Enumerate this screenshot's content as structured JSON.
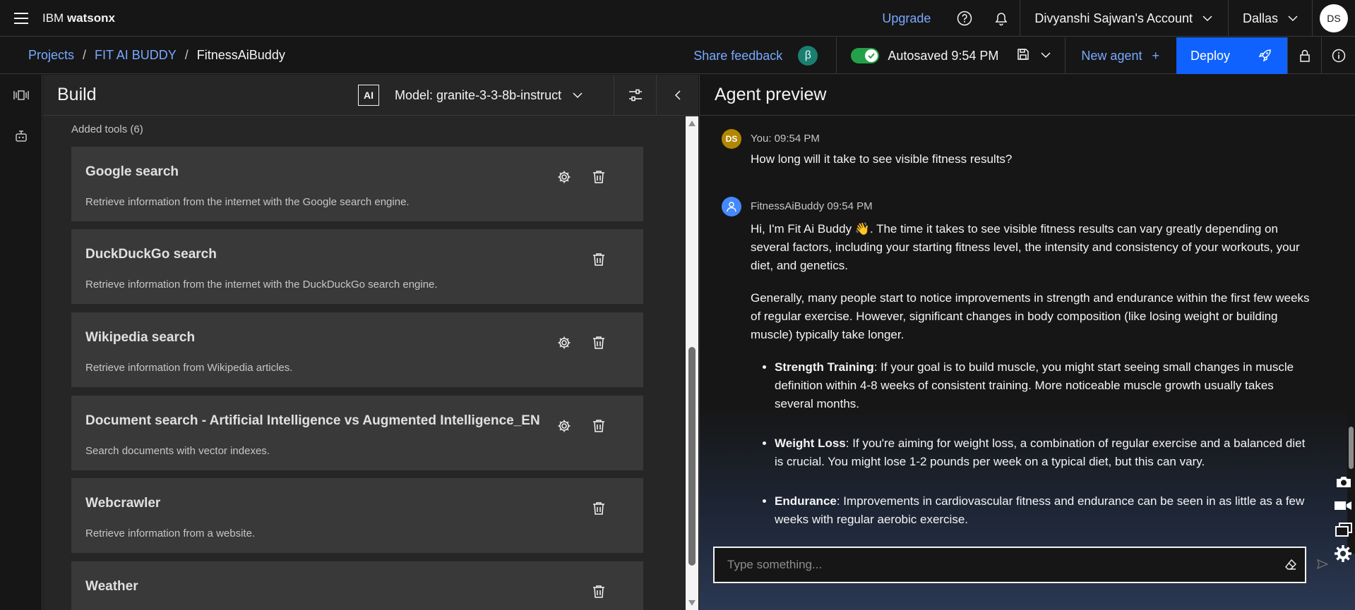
{
  "header": {
    "brand_prefix": "IBM ",
    "brand_name": "watsonx",
    "upgrade": "Upgrade",
    "account": "Divyanshi Sajwan's Account",
    "region": "Dallas",
    "avatar": "DS"
  },
  "subheader": {
    "breadcrumb": [
      "Projects",
      "FIT AI BUDDY",
      "FitnessAiBuddy"
    ],
    "separator": "/",
    "share_feedback": "Share feedback",
    "beta": "β",
    "autosaved": "Autosaved 9:54 PM",
    "new_agent": "New agent",
    "new_agent_plus": "+",
    "deploy": "Deploy"
  },
  "build": {
    "title": "Build",
    "ai_badge": "AI",
    "model": "Model: granite-3-3-8b-instruct",
    "tools_label": "Added tools (6)",
    "tools": [
      {
        "title": "Google search",
        "desc": "Retrieve information from the internet with the Google search engine.",
        "has_settings": true
      },
      {
        "title": "DuckDuckGo search",
        "desc": "Retrieve information from the internet with the DuckDuckGo search engine.",
        "has_settings": false
      },
      {
        "title": "Wikipedia search",
        "desc": "Retrieve information from Wikipedia articles.",
        "has_settings": true
      },
      {
        "title": "Document search - Artificial Intelligence vs Augmented Intelligence_EN",
        "desc": "Search documents with vector indexes.",
        "has_settings": true
      },
      {
        "title": "Webcrawler",
        "desc": "Retrieve information from a website.",
        "has_settings": false
      },
      {
        "title": "Weather",
        "desc": "",
        "has_settings": false
      }
    ]
  },
  "preview": {
    "title": "Agent preview",
    "user": {
      "avatar": "DS",
      "meta": "You: 09:54 PM",
      "text": "How long will it take to see visible fitness results?"
    },
    "bot": {
      "meta": "FitnessAiBuddy 09:54 PM",
      "p1": "Hi, I'm Fit Ai Buddy 👋. The time it takes to see visible fitness results can vary greatly depending on several factors, including your starting fitness level, the intensity and consistency of your workouts, your diet, and genetics.",
      "p2": "Generally, many people start to notice improvements in strength and endurance within the first few weeks of regular exercise. However, significant changes in body composition (like losing weight or building muscle) typically take longer.",
      "bullets": [
        {
          "term": "Strength Training",
          "text": ": If your goal is to build muscle, you might start seeing small changes in muscle definition within 4-8 weeks of consistent training. More noticeable muscle growth usually takes several months."
        },
        {
          "term": "Weight Loss",
          "text": ": If you're aiming for weight loss, a combination of regular exercise and a balanced diet is crucial. You might lose 1-2 pounds per week on a typical diet, but this can vary."
        },
        {
          "term": "Endurance",
          "text": ": Improvements in cardiovascular fitness and endurance can be seen in as little as a few weeks with regular aerobic exercise."
        }
      ]
    },
    "input_placeholder": "Type something..."
  },
  "colors": {
    "accent": "#0f62fe",
    "link": "#78a9ff",
    "toggle_on": "#24a148",
    "user_avatar": "#b28600",
    "bot_avatar": "#4589ff"
  },
  "icons": [
    "menu-icon",
    "help-icon",
    "notification-icon",
    "chevron-down-icon",
    "save-icon",
    "rocket-icon",
    "lock-icon",
    "info-icon",
    "settings-icon",
    "trash-icon",
    "sliders-icon",
    "chevron-left-icon",
    "eraser-icon",
    "send-icon",
    "camera-icon",
    "video-icon",
    "gear-icon"
  ]
}
